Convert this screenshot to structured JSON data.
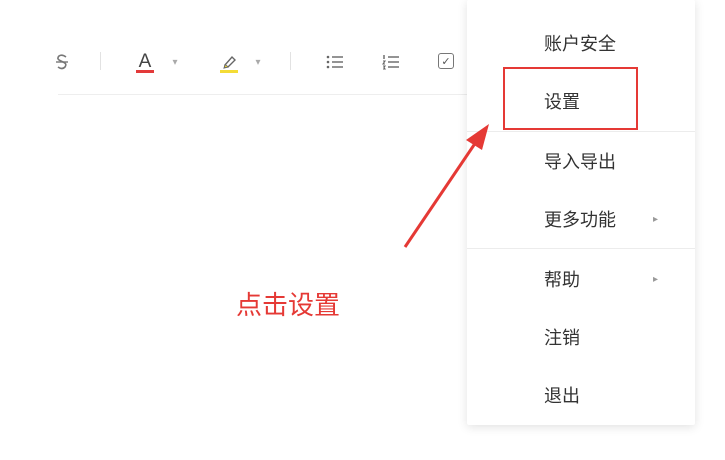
{
  "toolbar": {
    "strike_icon": "strikethrough-icon",
    "font_color_letter": "A",
    "font_color_bar": "#e33a3a",
    "highlight_bar": "#f4dc36",
    "caret": "▾",
    "bullet_list_icon": "☰",
    "ordered_list_icon": "☷",
    "checkbox_mark": "✓"
  },
  "menu": {
    "items": [
      {
        "label": "账户安全",
        "has_submenu": false
      },
      {
        "label": "设置",
        "has_submenu": false
      },
      {
        "label": "导入导出",
        "has_submenu": false
      },
      {
        "label": "更多功能",
        "has_submenu": true
      },
      {
        "label": "帮助",
        "has_submenu": true
      },
      {
        "label": "注销",
        "has_submenu": false
      },
      {
        "label": "退出",
        "has_submenu": false
      }
    ],
    "submenu_arrow": "▸"
  },
  "annotation": {
    "text": "点击设置",
    "color": "#e53935"
  }
}
